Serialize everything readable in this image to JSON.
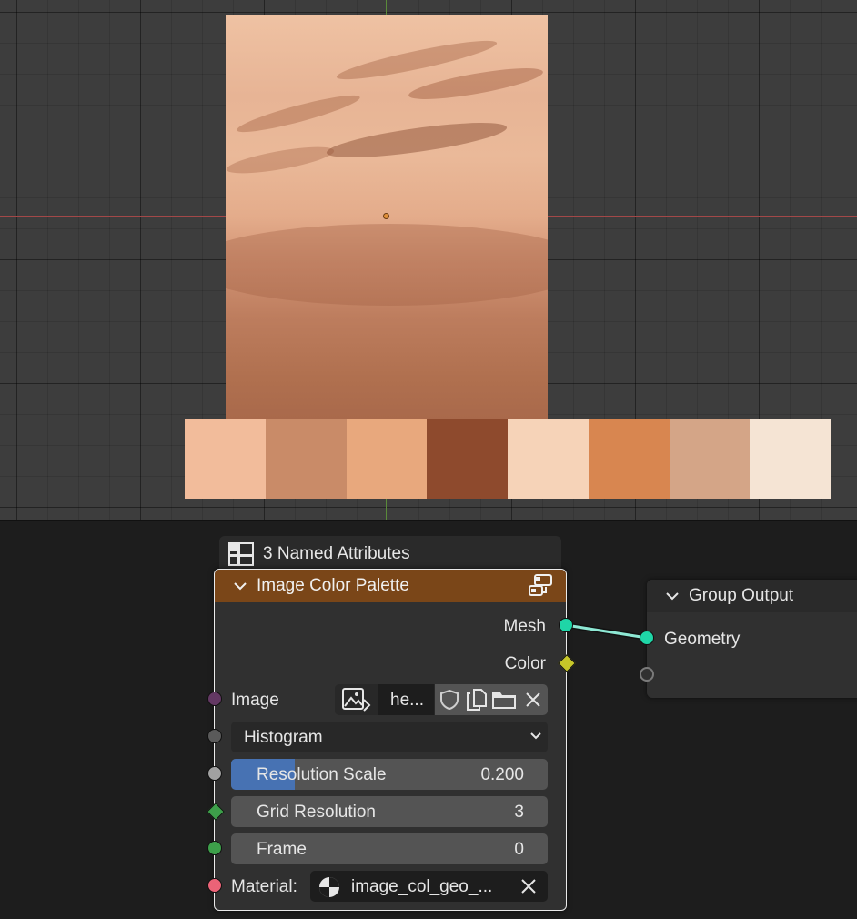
{
  "viewport": {
    "palette_colors": [
      "#f2bc9b",
      "#c98b68",
      "#e8a87d",
      "#8e4a2d",
      "#f6d3b8",
      "#d88650",
      "#d4a587",
      "#f5e4d4"
    ]
  },
  "frame": {
    "label": "3 Named Attributes",
    "icon": "frame-icon"
  },
  "node": {
    "title": "Image Color Palette",
    "header_color": "#7a4618",
    "outputs": {
      "mesh": "Mesh",
      "color": "Color"
    },
    "image": {
      "label": "Image",
      "name": "he...",
      "icons": [
        "image-icon",
        "shield-icon",
        "duplicate-icon",
        "folder-icon",
        "close-icon"
      ]
    },
    "method": {
      "value": "Histogram"
    },
    "resolution_scale": {
      "label": "Resolution Scale",
      "value": "0.200",
      "fill": 0.2
    },
    "grid_resolution": {
      "label": "Grid Resolution",
      "value": "3"
    },
    "frame": {
      "label": "Frame",
      "value": "0"
    },
    "material": {
      "label": "Material:",
      "value": "image_col_geo_..."
    }
  },
  "group_output": {
    "title": "Group Output",
    "geometry": "Geometry"
  },
  "colors": {
    "geometry_socket": "#1fd6a7",
    "color_socket": "#c7c729",
    "image_socket": "#633863",
    "int_socket": "#3d9f4a",
    "material_socket": "#eb6377",
    "float_socket": "#a1a1a1",
    "menu_socket": "#5a5a5a",
    "accent_blue": "#4772b3"
  }
}
